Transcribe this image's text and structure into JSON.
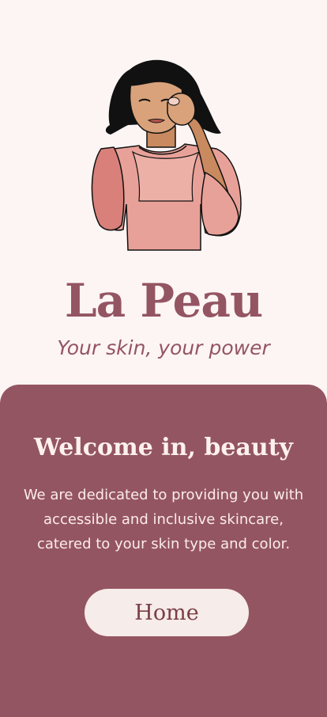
{
  "brand": {
    "title": "La Peau",
    "tagline": "Your skin, your power"
  },
  "welcome": {
    "heading": "Welcome in, beauty",
    "body": "We are dedicated to providing you with accessible and inclusive skincare, catered to your skin type and color."
  },
  "actions": {
    "home_label": "Home"
  },
  "colors": {
    "background": "#fdf5f4",
    "brand": "#945562",
    "card": "#945562",
    "button_bg": "#f6ece9",
    "button_text": "#7a3e45"
  },
  "icons": {
    "hero": "woman-skincare-illustration"
  }
}
